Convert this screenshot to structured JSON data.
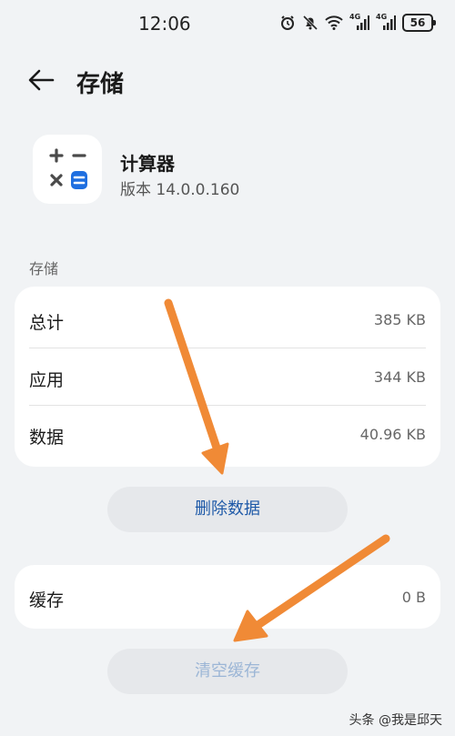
{
  "status_bar": {
    "time": "12:06",
    "net1": "4G",
    "net2": "4G",
    "battery": "56",
    "icons": [
      "alarm-icon",
      "mute-icon",
      "wifi-icon",
      "signal-icon",
      "signal-icon",
      "battery-icon"
    ]
  },
  "header": {
    "title": "存储",
    "back_icon": "back-arrow-icon"
  },
  "app": {
    "name": "计算器",
    "version": "版本 14.0.0.160",
    "icon": "calculator-icon",
    "accent": "#1f6fe0"
  },
  "storage": {
    "section_label": "存储",
    "rows": [
      {
        "label": "总计",
        "value": "385 KB"
      },
      {
        "label": "应用",
        "value": "344 KB"
      },
      {
        "label": "数据",
        "value": "40.96 KB"
      }
    ],
    "delete_button": "删除数据"
  },
  "cache": {
    "label": "缓存",
    "value": "0 B",
    "clear_button": "清空缓存"
  },
  "annotations": {
    "arrow_color": "#f08a36"
  },
  "watermark": "头条 @我是邱天"
}
